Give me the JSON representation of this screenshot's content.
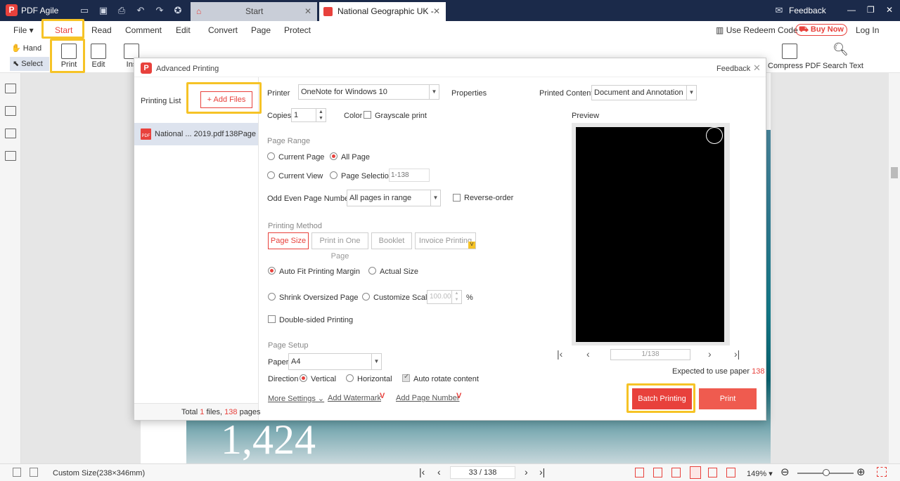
{
  "app": {
    "name": "PDF Agile"
  },
  "tabs": [
    {
      "label": "Start"
    },
    {
      "label": "National Geographic UK - J..."
    }
  ],
  "titlebar": {
    "feedback": "Feedback"
  },
  "menu": {
    "file": "File",
    "items": [
      "Start",
      "Read",
      "Comment",
      "Edit",
      "Convert",
      "Page",
      "Protect"
    ],
    "redeem": "Use Redeem Code",
    "buy": "Buy Now",
    "login": "Log In"
  },
  "toolbar": {
    "hand": "Hand",
    "select": "Select",
    "print": "Print",
    "edit": "Edit",
    "insert": "Ins",
    "zoom": "149%",
    "page": "33 / 138",
    "compress": "Compress PDF",
    "search": "Search Text"
  },
  "dialog": {
    "title": "Advanced Printing",
    "feedback": "Feedback",
    "printing_list": "Printing List",
    "add_files": "+ Add Files",
    "file": {
      "name": "National ... 2019.pdf",
      "pages": "138Page"
    },
    "total": {
      "prefix": "Total ",
      "files": "1",
      "mid": " files, ",
      "pages": "138",
      "suffix": " pages"
    },
    "printer_label": "Printer",
    "printer_value": "OneNote for Windows 10",
    "properties": "Properties",
    "printed_content_label": "Printed Content",
    "printed_content_value": "Document and Annotation",
    "copies_label": "Copies",
    "copies_value": "1",
    "color_label": "Color",
    "grayscale": "Grayscale print",
    "page_range": "Page Range",
    "current_page": "Current Page",
    "all_page": "All Page",
    "current_view": "Current View",
    "page_selection": "Page Selection",
    "page_selection_placeholder": "1-138",
    "odd_even_label": "Odd Even Page Numbers",
    "odd_even_value": "All pages in range",
    "reverse_order": "Reverse-order",
    "printing_method": "Printing Method",
    "methods": [
      "Page Size",
      "Print in One Page",
      "Booklet",
      "Invoice Printing"
    ],
    "auto_fit": "Auto Fit Printing Margin",
    "actual_size": "Actual Size",
    "shrink": "Shrink Oversized Page",
    "customize_scale": "Customize Scale",
    "scale_value": "100.00",
    "percent": "%",
    "double_sided": "Double-sided Printing",
    "page_setup": "Page Setup",
    "paper_label": "Paper",
    "paper_value": "A4",
    "direction_label": "Direction",
    "vertical": "Vertical",
    "horizontal": "Horizontal",
    "auto_rotate": "Auto rotate content",
    "more_settings": "More Settings",
    "add_watermark": "Add Watermark",
    "add_page_number": "Add Page Number",
    "preview_label": "Preview",
    "preview_page": "1/138",
    "expected": "Expected to use paper ",
    "expected_count": "138",
    "batch_printing": "Batch Printing",
    "print": "Print"
  },
  "document": {
    "big_number": "1,424"
  },
  "status": {
    "size": "Custom Size(238×346mm)",
    "page": "33 / 138",
    "zoom": "149%"
  },
  "colors": {
    "accent": "#e8413c",
    "titlebar": "#1b2a4a",
    "highlight": "#f6c326"
  }
}
